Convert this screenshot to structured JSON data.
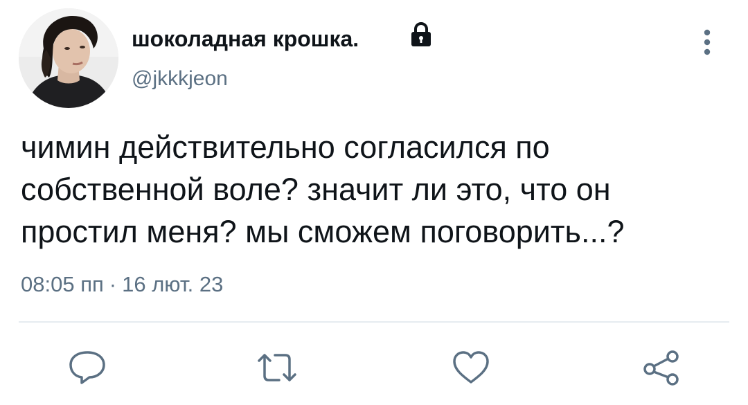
{
  "author": {
    "display_name": "шоколадная крошка.",
    "handle": "@jkkkjeon",
    "avatar_icon": "profile-photo",
    "protected_icon": "lock-icon"
  },
  "tweet": {
    "text": "чимин действительно согласился по собственной воле? значит ли это, что он простил меня? мы сможем поговорить...?",
    "time": "08:05 пп",
    "separator": "·",
    "date": "16 лют. 23"
  },
  "actions": {
    "reply_icon": "reply-icon",
    "retweet_icon": "retweet-icon",
    "like_icon": "heart-icon",
    "share_icon": "share-icon",
    "more_icon": "more-vertical-icon"
  },
  "colors": {
    "text": "#0f1419",
    "secondary": "#5b7083",
    "divider": "#e6ecf0",
    "icon": "#5b7083"
  }
}
